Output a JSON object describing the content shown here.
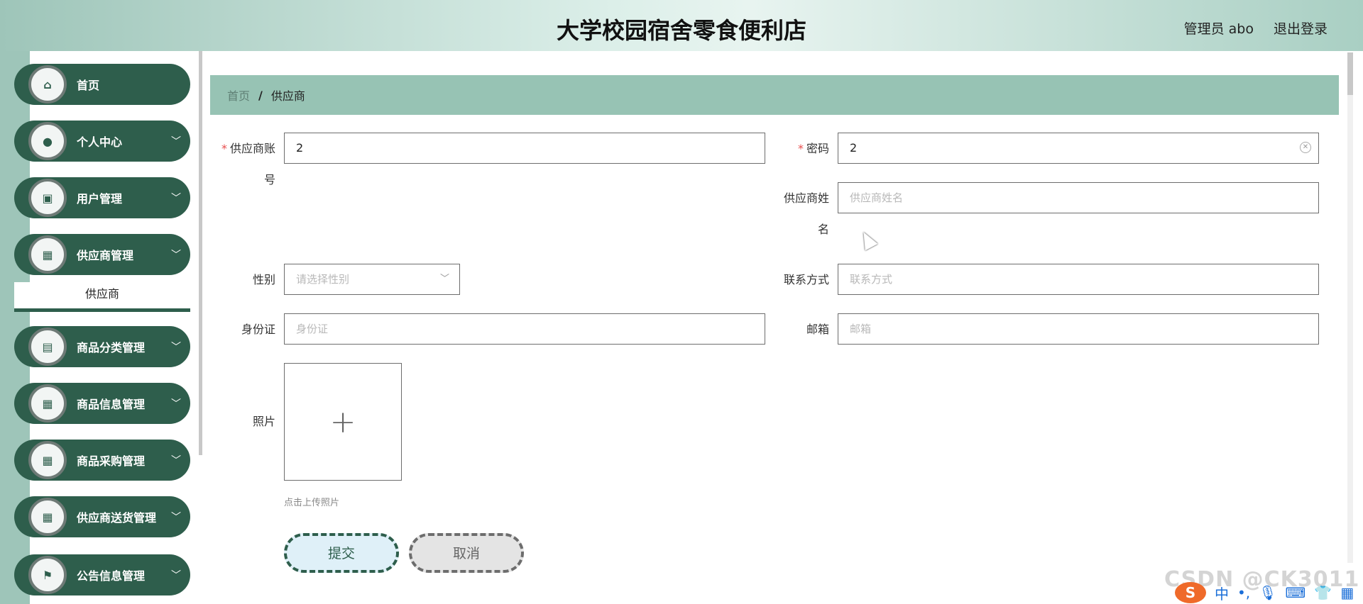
{
  "header": {
    "title": "大学校园宿舍零食便利店",
    "user_label": "管理员 abo",
    "logout_label": "退出登录"
  },
  "sidebar": {
    "items": [
      {
        "label": "首页",
        "icon": "home-icon",
        "has_chevron": false
      },
      {
        "label": "个人中心",
        "icon": "user-icon",
        "has_chevron": true
      },
      {
        "label": "用户管理",
        "icon": "chart-icon",
        "has_chevron": true
      },
      {
        "label": "供应商管理",
        "icon": "grid-icon",
        "has_chevron": true
      },
      {
        "label": "商品分类管理",
        "icon": "clipboard-icon",
        "has_chevron": true
      },
      {
        "label": "商品信息管理",
        "icon": "grid-icon",
        "has_chevron": true
      },
      {
        "label": "商品采购管理",
        "icon": "grid-icon",
        "has_chevron": true
      },
      {
        "label": "供应商送货管理",
        "icon": "grid-icon",
        "has_chevron": true
      },
      {
        "label": "公告信息管理",
        "icon": "flag-icon",
        "has_chevron": true
      }
    ],
    "submenu": {
      "label": "供应商"
    }
  },
  "breadcrumb": {
    "home": "首页",
    "separator": "/",
    "current": "供应商"
  },
  "form": {
    "account": {
      "label_line1": "供应商账",
      "label_line2": "号",
      "value": "2",
      "required": true
    },
    "password": {
      "label": "密码",
      "value": "2",
      "required": true
    },
    "name": {
      "label_line1": "供应商姓",
      "label_line2": "名",
      "placeholder": "供应商姓名"
    },
    "gender": {
      "label": "性别",
      "placeholder": "请选择性别"
    },
    "contact": {
      "label": "联系方式",
      "placeholder": "联系方式"
    },
    "id_card": {
      "label": "身份证",
      "placeholder": "身份证"
    },
    "email": {
      "label": "邮箱",
      "placeholder": "邮箱"
    },
    "photo": {
      "label": "照片",
      "tip": "点击上传照片"
    },
    "submit_label": "提交",
    "cancel_label": "取消"
  },
  "overlay": {
    "watermark": "CSDN @CK3011",
    "ime_logo": "S",
    "ime_chinese": "中"
  },
  "colors": {
    "accent": "#2e5e4c",
    "breadcrumb_bg": "#97c3b4",
    "required": "#e84d4d"
  }
}
